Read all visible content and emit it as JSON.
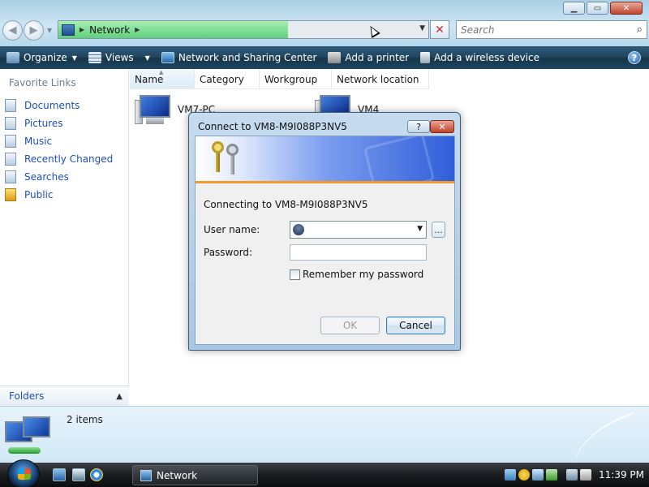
{
  "address": {
    "location": "Network",
    "progress": 0.62
  },
  "search": {
    "placeholder": "Search"
  },
  "toolbar": {
    "organize": "Organize",
    "views": "Views",
    "network_center": "Network and Sharing Center",
    "add_printer": "Add a printer",
    "add_wireless": "Add a wireless device",
    "help": "?"
  },
  "sidebar": {
    "header": "Favorite Links",
    "items": [
      {
        "label": "Documents"
      },
      {
        "label": "Pictures"
      },
      {
        "label": "Music"
      },
      {
        "label": "Recently Changed"
      },
      {
        "label": "Searches"
      },
      {
        "label": "Public"
      }
    ],
    "folders_label": "Folders"
  },
  "columns": [
    "Name",
    "Category",
    "Workgroup",
    "Network location"
  ],
  "computers": [
    {
      "name": "VM7-PC"
    },
    {
      "name": "VM4"
    }
  ],
  "details": {
    "item_count": "2 items"
  },
  "dialog": {
    "title": "Connect to VM8-M9I088P3NV5",
    "help_label": "?",
    "close_label": "✕",
    "connecting_text": "Connecting to VM8-M9I088P3NV5",
    "user_label": "User name:",
    "user_value": "",
    "password_label": "Password:",
    "browse_label": "...",
    "remember_label": "Remember my password",
    "remember_checked": false,
    "ok_label": "OK",
    "cancel_label": "Cancel"
  },
  "taskbar": {
    "window_button": "Network",
    "clock": "11:39 PM"
  }
}
